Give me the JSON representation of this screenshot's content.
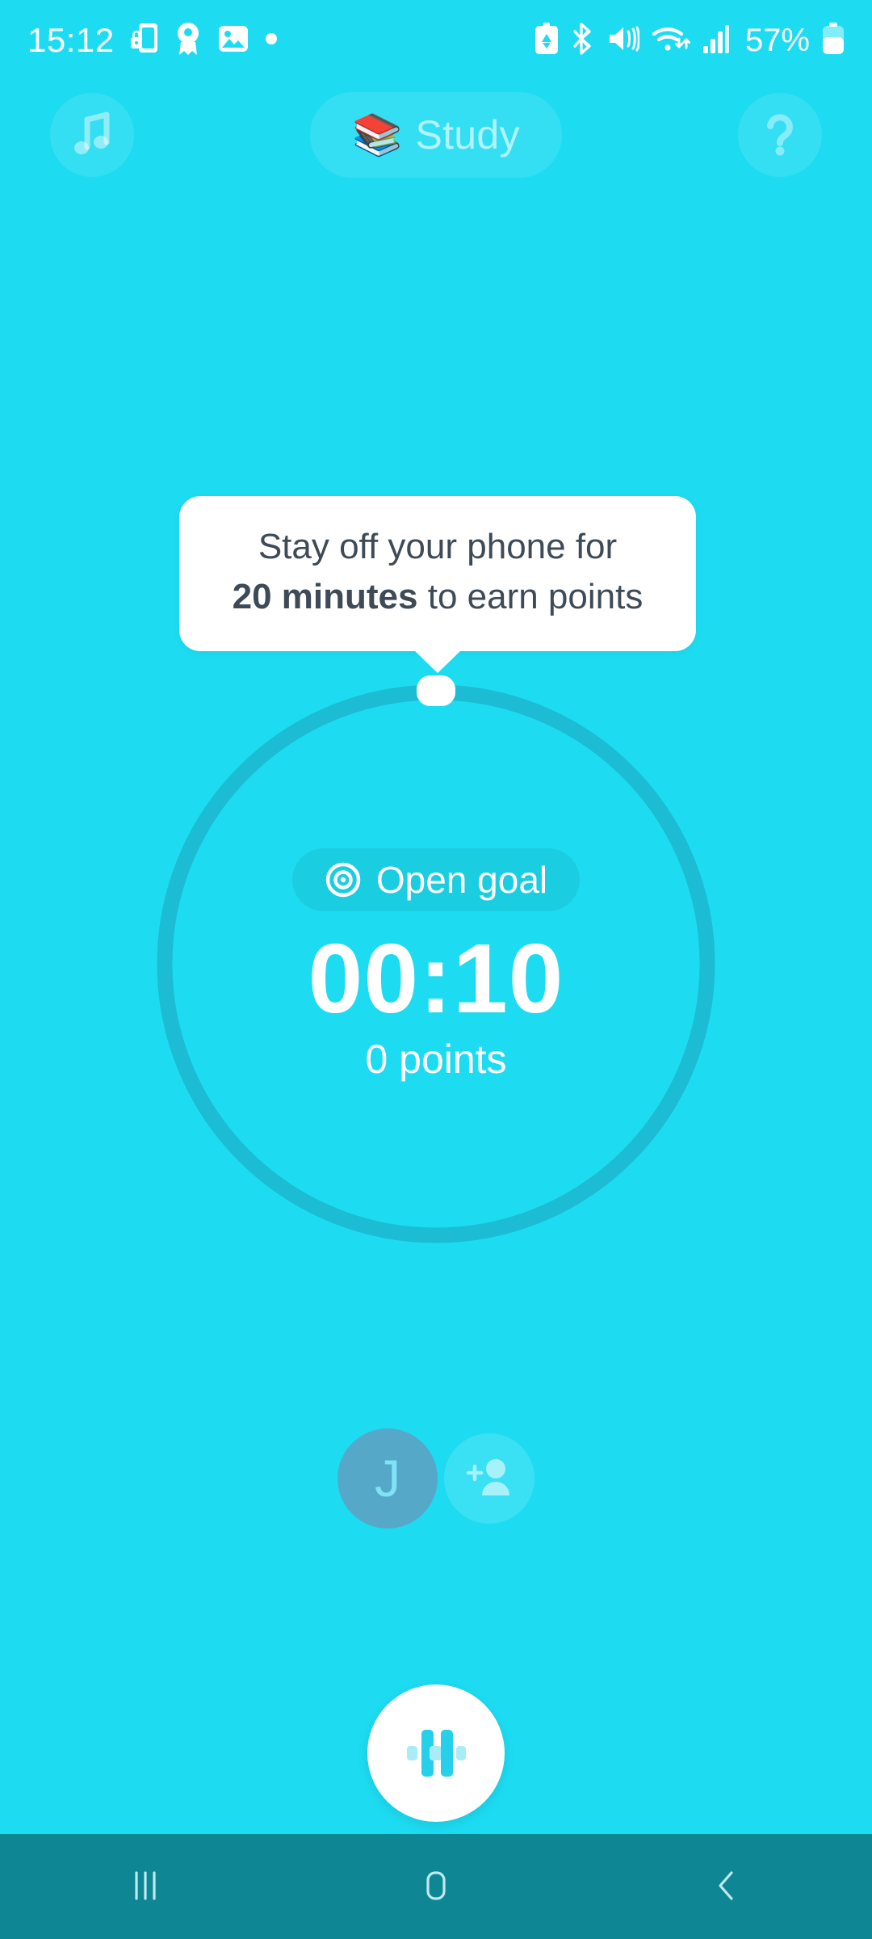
{
  "theme": {
    "background": "#1DDCF2",
    "ring_track": "#1BBCD4",
    "nav_background": "#0F8694",
    "tooltip_background": "#FFFFFF",
    "tooltip_text": "#3E4A56",
    "avatar_background": "#56A8C9",
    "accent_white": "#FFFFFF"
  },
  "status_bar": {
    "time": "15:12",
    "battery_percent": "57%",
    "left_icons": [
      "secure-folder-icon",
      "badge-icon",
      "gallery-icon",
      "dot-indicator-icon"
    ],
    "right_icons": [
      "battery-saver-icon",
      "bluetooth-icon",
      "mute-icon",
      "wifi-icon",
      "cellular-signal-icon",
      "battery-icon"
    ]
  },
  "header": {
    "music_button_icon": "music-note-icon",
    "title_emoji": "📚",
    "title": "Study",
    "help_button_icon": "question-mark-icon"
  },
  "tooltip": {
    "line1": "Stay off your phone for",
    "duration": "20 minutes",
    "line2_suffix": " to earn points"
  },
  "timer": {
    "goal_icon": "target-icon",
    "goal_label": "Open goal",
    "time_remaining": "00:10",
    "points": "0 points",
    "ring_progress_percent": 0
  },
  "participants": {
    "avatars": [
      {
        "initial": "J",
        "name": "participant-avatar-j"
      }
    ],
    "add_button_icon": "add-person-icon"
  },
  "controls": {
    "pause_button_icon": "pause-icon"
  },
  "nav_bar": {
    "recents_icon": "recents-icon",
    "home_icon": "home-icon",
    "back_icon": "back-icon"
  }
}
